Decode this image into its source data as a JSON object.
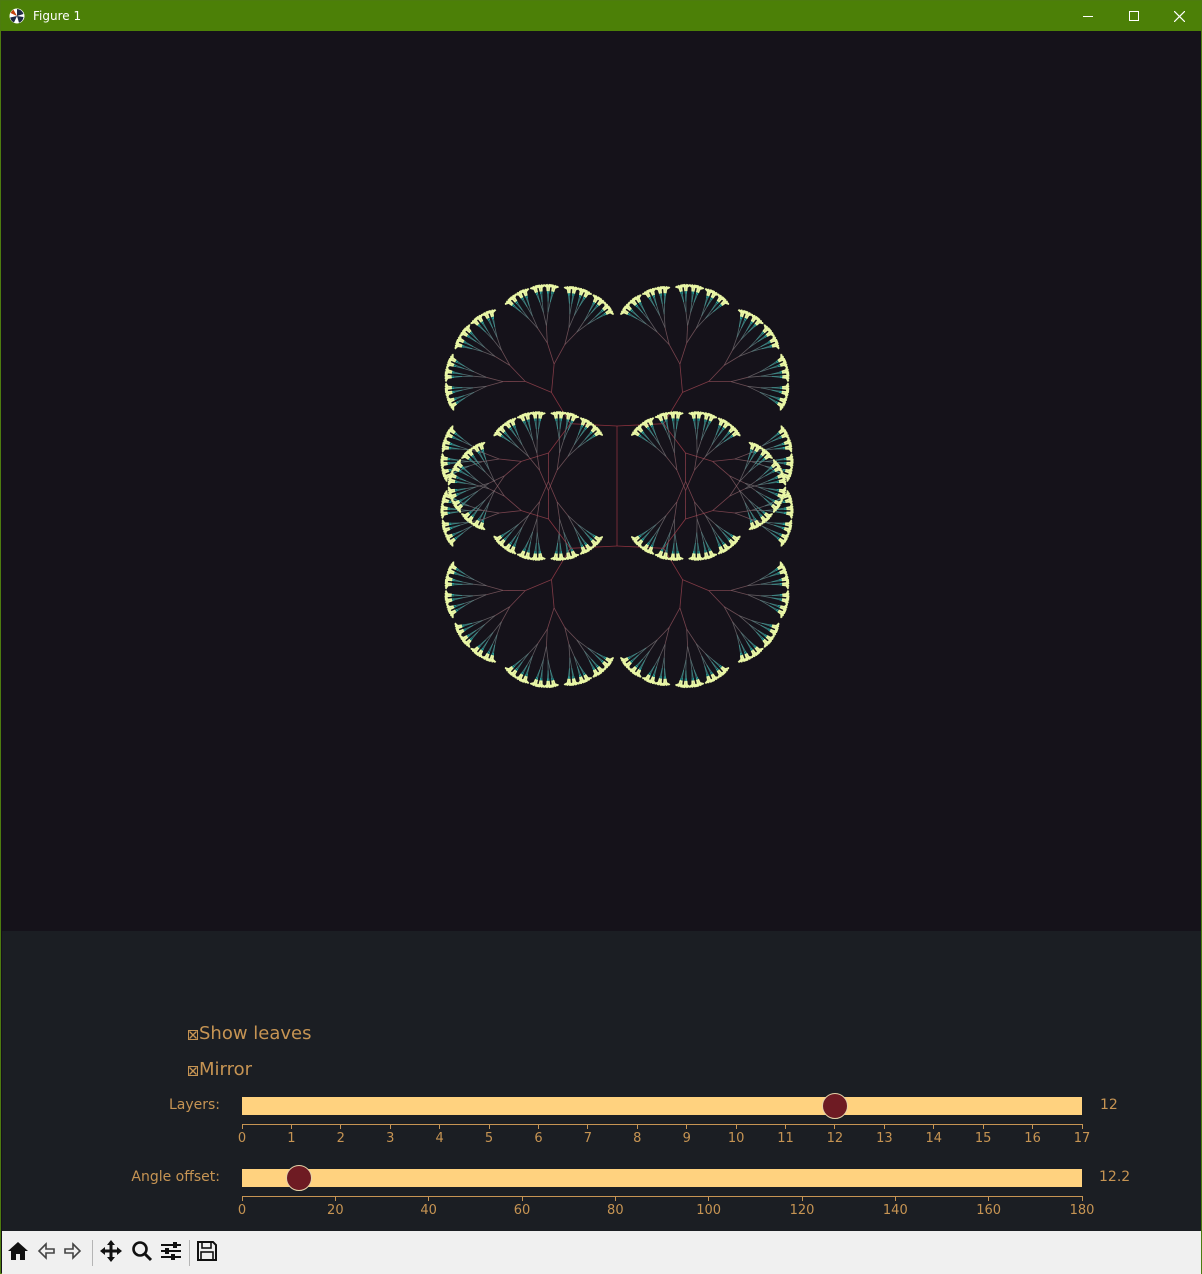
{
  "window": {
    "title": "Figure 1"
  },
  "icons": {
    "app": "matplotlib-logo-icon",
    "minimize": "minimize-icon",
    "maximize": "maximize-icon",
    "close": "close-icon"
  },
  "colors": {
    "background": "#15121a",
    "panel": "#1b1e23",
    "branch": "#b23a48",
    "branch_outer": "#2fb8b0",
    "leaf": "#eaf7a6",
    "accent": "#c69453",
    "track": "#ffd27f",
    "knob": "#6e1b23"
  },
  "controls": {
    "show_leaves": {
      "label": "Show leaves",
      "checked": true
    },
    "mirror": {
      "label": "Mirror",
      "checked": true
    }
  },
  "sliders": {
    "layers": {
      "label": "Layers:",
      "min": 0,
      "max": 17,
      "value": 12,
      "value_text": "12",
      "ticks": [
        "0",
        "1",
        "2",
        "3",
        "4",
        "5",
        "6",
        "7",
        "8",
        "9",
        "10",
        "11",
        "12",
        "13",
        "14",
        "15",
        "16",
        "17"
      ]
    },
    "angle": {
      "label": "Angle offset:",
      "min": 0,
      "max": 180,
      "value": 12.2,
      "value_text": "12.2",
      "ticks": [
        "0",
        "20",
        "40",
        "60",
        "80",
        "100",
        "120",
        "140",
        "160",
        "180"
      ]
    }
  },
  "toolbar": [
    {
      "name": "home-icon"
    },
    {
      "name": "back-icon"
    },
    {
      "name": "forward-icon"
    },
    {
      "name": "pan-icon"
    },
    {
      "name": "zoom-icon"
    },
    {
      "name": "configure-subplots-icon"
    },
    {
      "name": "save-icon"
    }
  ]
}
